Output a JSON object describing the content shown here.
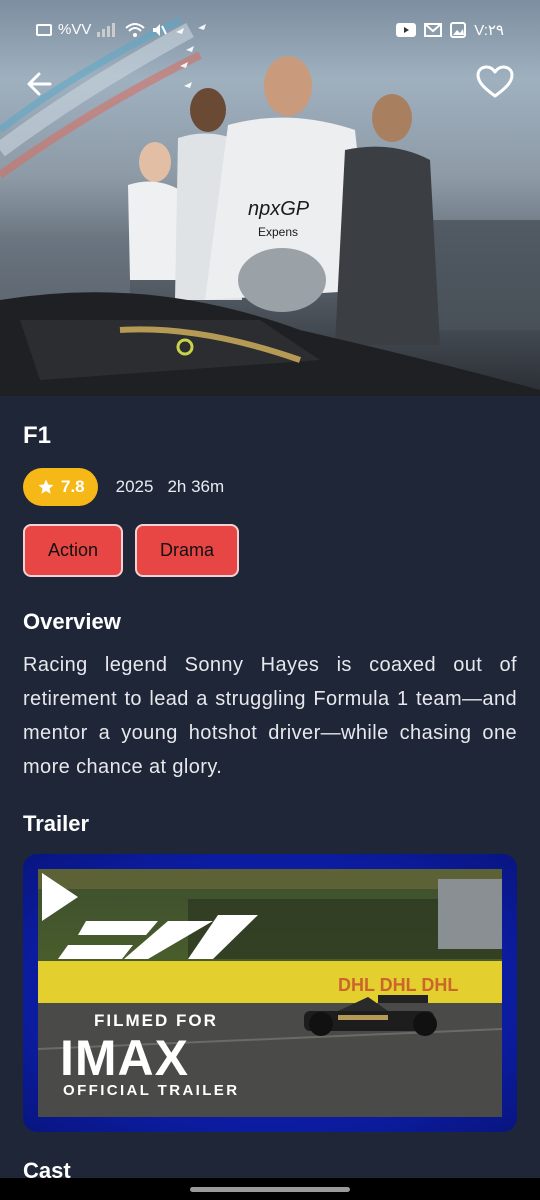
{
  "status_bar": {
    "left_text": "%VV",
    "time": "V:٢٩",
    "icons": [
      "battery-icon",
      "signal-icon",
      "wifi-icon",
      "mute-icon",
      "youtube-icon",
      "gmail-icon",
      "gallery-icon"
    ]
  },
  "header": {
    "back_icon": "arrow-left-icon",
    "favorite_icon": "heart-outline-icon"
  },
  "movie": {
    "title": "F1",
    "rating": "7.8",
    "year": "2025",
    "runtime": "2h 36m",
    "genres": [
      "Action",
      "Drama"
    ],
    "overview_heading": "Overview",
    "overview": "Racing legend Sonny Hayes is coaxed out of retirement to lead a struggling Formula 1 team—and mentor a young hotshot driver—while chasing one more chance at glory.",
    "trailer_heading": "Trailer",
    "cast_heading": "Cast"
  },
  "trailer": {
    "filmed_for": "FILMED FOR",
    "imax": "IMAX",
    "official_trailer": "OFFICIAL TRAILER",
    "play_icon": "play-icon"
  },
  "colors": {
    "background": "#1e2638",
    "rating_badge": "#f6b817",
    "genre_chip": "#e84545",
    "trailer_frame": "#1a2fe0"
  }
}
